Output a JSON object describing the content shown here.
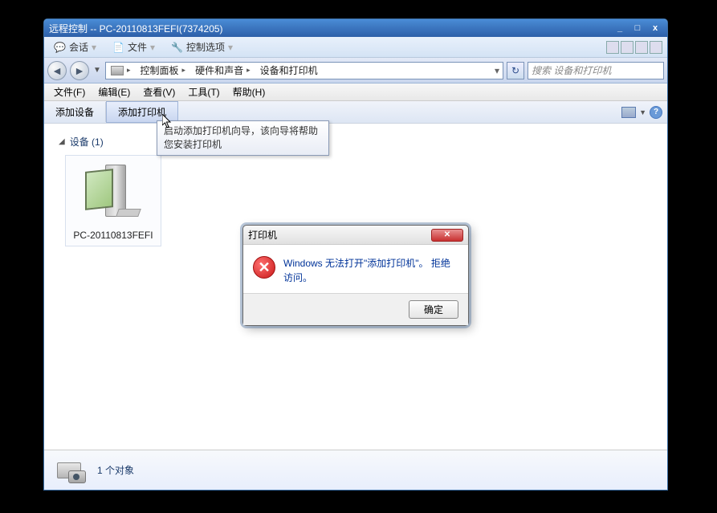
{
  "window": {
    "title": "远程控制 -- PC-20110813FEFI(7374205)"
  },
  "remoteToolbar": {
    "session": "会话",
    "file": "文件",
    "controlOptions": "控制选项"
  },
  "breadcrumb": {
    "items": [
      "控制面板",
      "硬件和声音",
      "设备和打印机"
    ]
  },
  "search": {
    "placeholder": "搜索 设备和打印机"
  },
  "menu": {
    "file": "文件(F)",
    "edit": "编辑(E)",
    "view": "查看(V)",
    "tools": "工具(T)",
    "help": "帮助(H)"
  },
  "commandBar": {
    "addDevice": "添加设备",
    "addPrinter": "添加打印机"
  },
  "tooltip": {
    "line1": "启动添加打印机向导，该向导将帮助",
    "line2": "您安装打印机"
  },
  "group": {
    "devices": "设备 (1)"
  },
  "device": {
    "name": "PC-20110813FEFI"
  },
  "statusBar": {
    "text": "1 个对象"
  },
  "dialog": {
    "title": "打印机",
    "message": "Windows 无法打开\"添加打印机\"。 拒绝访问。",
    "ok": "确定"
  }
}
